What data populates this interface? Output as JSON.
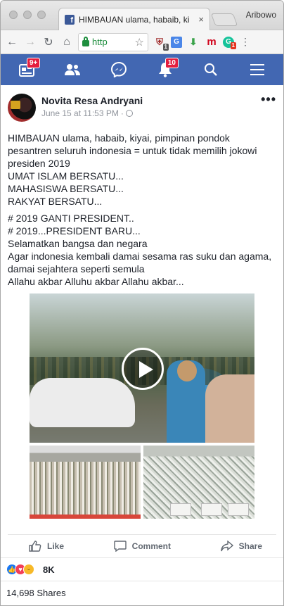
{
  "browser": {
    "tab_title": "HIMBAUAN ulama, habaib, ki",
    "tab_close": "×",
    "profile_name": "Aribowo",
    "url_text": "http",
    "extensions": [
      {
        "name": "ublock-icon",
        "badge": "1"
      },
      {
        "name": "translate-icon",
        "badge": ""
      },
      {
        "name": "download-icon",
        "badge": ""
      },
      {
        "name": "mendeley-icon",
        "badge": ""
      },
      {
        "name": "grammarly-icon",
        "badge": "1"
      }
    ]
  },
  "fb_nav": {
    "home_badge": "9+",
    "notifications_badge": "10"
  },
  "post": {
    "author": "Novita Resa Andryani",
    "timestamp": "June 15 at 11:53 PM",
    "paragraph_1": [
      "HIMBAUAN ulama, habaib, kiyai, pimpinan pondok pesantren seluruh indonesia = untuk tidak memilih jokowi presiden 2019",
      "UMAT ISLAM BERSATU...",
      "MAHASISWA BERSATU...",
      "RAKYAT BERSATU..."
    ],
    "paragraph_2": [
      "# 2019 GANTI PRESIDENT..",
      "# 2019...PRESIDENT BARU...",
      "Selamatkan bangsa dan negara",
      "Agar indonesia kembali damai sesama ras suku dan agama, damai sejahtera seperti semula",
      "Allahu akbar Alluhu akbar Allahu akbar..."
    ],
    "actions": {
      "like": "Like",
      "comment": "Comment",
      "share": "Share"
    },
    "reactions_count": "8K",
    "shares": "14,698 Shares"
  }
}
